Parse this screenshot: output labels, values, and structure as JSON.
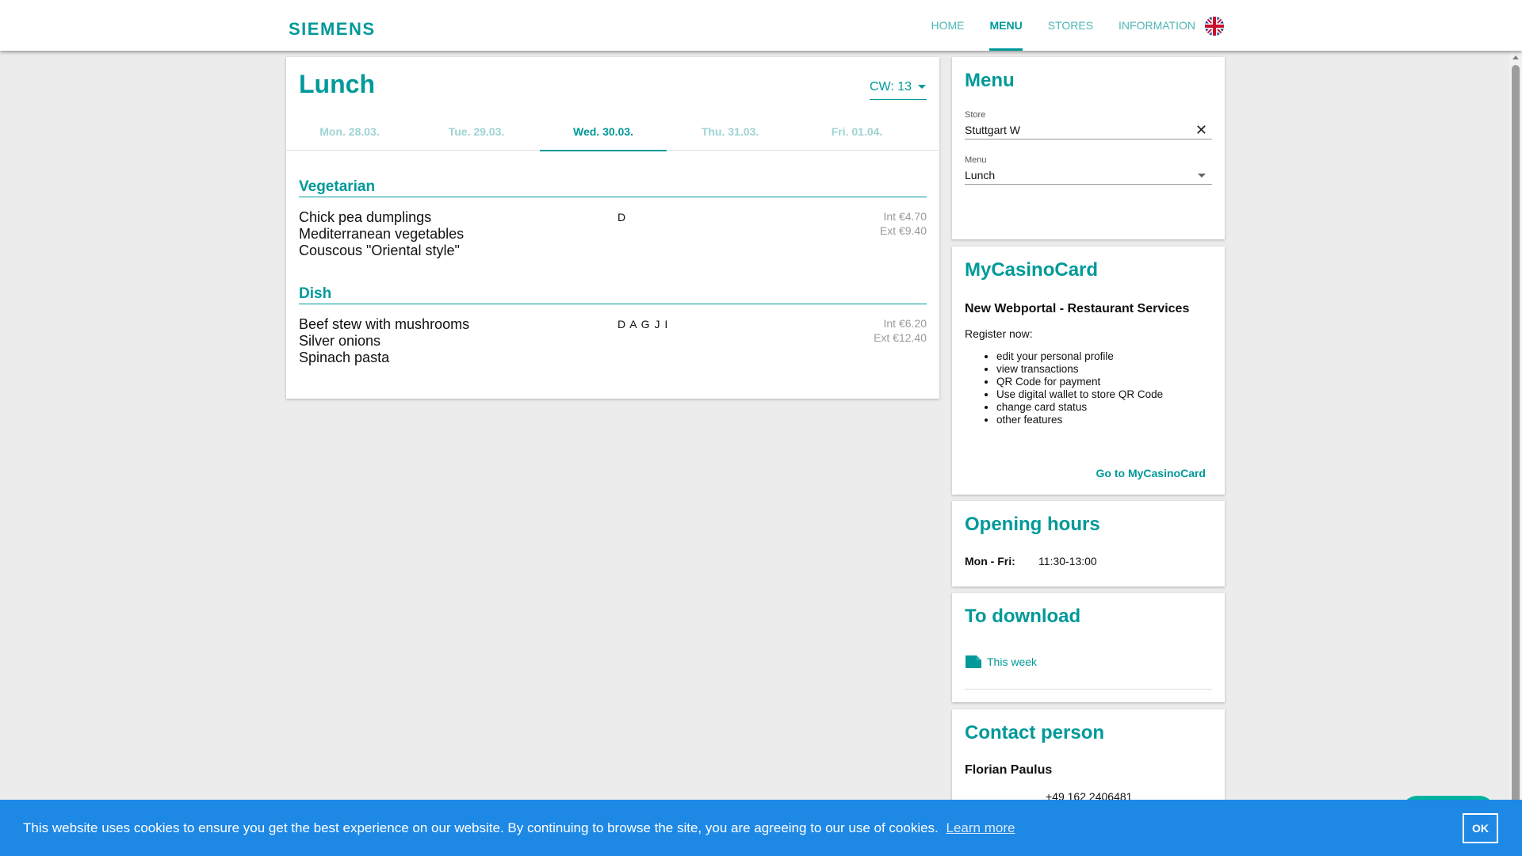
{
  "header": {
    "logo": "SIEMENS",
    "nav": [
      {
        "label": "HOME",
        "active": false
      },
      {
        "label": "MENU",
        "active": true
      },
      {
        "label": "STORES",
        "active": false
      },
      {
        "label": "INFORMATION",
        "active": false
      }
    ],
    "language_icon": "uk-flag-icon"
  },
  "lunch": {
    "title": "Lunch",
    "calendar_week": "CW: 13",
    "days": [
      {
        "label": "Mon. 28.03.",
        "active": false
      },
      {
        "label": "Tue. 29.03.",
        "active": false
      },
      {
        "label": "Wed. 30.03.",
        "active": true
      },
      {
        "label": "Thu. 31.03.",
        "active": false
      },
      {
        "label": "Fri. 01.04.",
        "active": false
      }
    ],
    "sections": [
      {
        "title": "Vegetarian",
        "lines": [
          "Chick pea dumplings",
          "Mediterranean vegetables",
          "Couscous \"Oriental style\""
        ],
        "allergens": "D",
        "price_int": "Int €4.70",
        "price_ext": "Ext €9.40"
      },
      {
        "title": "Dish",
        "lines": [
          "Beef stew with mushrooms",
          "Silver onions",
          "Spinach pasta"
        ],
        "allergens": "D A G J I",
        "price_int": "Int €6.20",
        "price_ext": "Ext €12.40"
      }
    ]
  },
  "menu_card": {
    "title": "Menu",
    "store_label": "Store",
    "store_value": "Stuttgart W",
    "menu_label": "Menu",
    "menu_value": "Lunch"
  },
  "mycasino": {
    "title": "MyCasinoCard",
    "subtitle": "New Webportal - Restaurant Services",
    "register": "Register now:",
    "features": [
      "edit your personal profile",
      "view transactions",
      "QR Code for payment",
      "Use digital wallet to store QR Code",
      "change card status",
      "other features"
    ],
    "link": "Go to MyCasinoCard"
  },
  "opening": {
    "title": "Opening hours",
    "days": "Mon - Fri:",
    "hours": "11:30-13:00"
  },
  "download": {
    "title": "To download",
    "item": "This week"
  },
  "contact": {
    "title": "Contact person",
    "name": "Florian Paulus",
    "phone": "+49 162 2406481"
  },
  "cookie": {
    "text": "This website uses cookies to ensure you get the best experience on our website. By continuing to browse the site, you are agreeing to our use of cookies.",
    "link": "Learn more",
    "ok": "OK"
  },
  "colors": {
    "accent": "#009999",
    "cookie_bar": "#1e88e5",
    "background": "#ececec"
  }
}
